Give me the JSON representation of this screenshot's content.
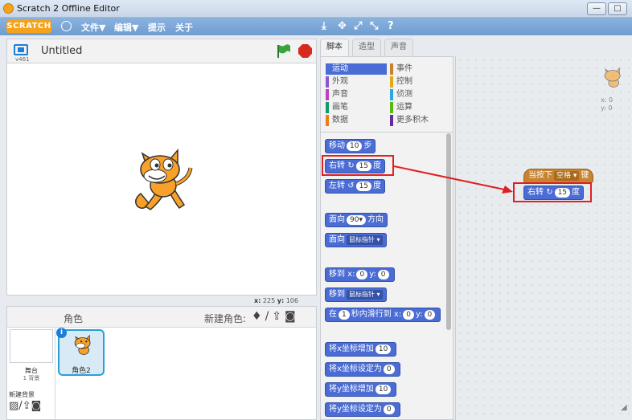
{
  "window": {
    "title": "Scratch 2 Offline Editor",
    "min_glyph": "—",
    "max_glyph": "□"
  },
  "menubar": {
    "logo": "SCRATCH",
    "file": "文件▼",
    "edit": "编辑▼",
    "tips": "提示",
    "about": "关于",
    "tools": [
      "⤓",
      "✥",
      "⤢",
      "⤡",
      "?"
    ]
  },
  "stage": {
    "version": "v461",
    "project_title": "Untitled",
    "coords": {
      "x_label": "x:",
      "x": "225",
      "y_label": "y:",
      "y": "106"
    }
  },
  "sprites": {
    "label": "角色",
    "new_sprite_label": "新建角色:",
    "stage_name": "舞台",
    "stage_backdrops": "1 背景",
    "new_backdrop_label": "新建背景",
    "sprite_name": "角色2",
    "info": "i"
  },
  "tabs": [
    "脚本",
    "造型",
    "声音"
  ],
  "categories": [
    {
      "label": "运动",
      "color": "#4a6cd4",
      "selected": true
    },
    {
      "label": "事件",
      "color": "#c88330"
    },
    {
      "label": "外观",
      "color": "#8a55d7"
    },
    {
      "label": "控制",
      "color": "#e1a91a"
    },
    {
      "label": "声音",
      "color": "#bb42c3"
    },
    {
      "label": "侦测",
      "color": "#2ca5e2"
    },
    {
      "label": "画笔",
      "color": "#0e9a6c"
    },
    {
      "label": "运算",
      "color": "#5cb712"
    },
    {
      "label": "数据",
      "color": "#ee7d16"
    },
    {
      "label": "更多积木",
      "color": "#632d99"
    }
  ],
  "blocks": {
    "move": {
      "a": "移动",
      "n": "10",
      "b": "步"
    },
    "turn_right": {
      "a": "右转",
      "icon": "↻",
      "n": "15",
      "b": "度"
    },
    "turn_left": {
      "a": "左转",
      "icon": "↺",
      "n": "15",
      "b": "度"
    },
    "point_dir": {
      "a": "面向",
      "n": "90▾",
      "b": "方向"
    },
    "point_towards": {
      "a": "面向",
      "d": "鼠标指针 ▾"
    },
    "goto_xy": {
      "a": "移到 x:",
      "n1": "0",
      "m": "y:",
      "n2": "0"
    },
    "goto": {
      "a": "移到",
      "d": "鼠标指针 ▾"
    },
    "glide": {
      "a": "在",
      "n1": "1",
      "m": "秒内滑行到 x:",
      "n2": "0",
      "m2": "y:",
      "n3": "0"
    },
    "change_x": {
      "a": "将x坐标增加",
      "n": "10"
    },
    "set_x": {
      "a": "将x坐标设定为",
      "n": "0"
    },
    "change_y": {
      "a": "将y坐标增加",
      "n": "10"
    },
    "set_y": {
      "a": "将y坐标设定为",
      "n": "0"
    }
  },
  "script": {
    "hat": {
      "a": "当按下",
      "key": "空格 ▾",
      "b": "键"
    },
    "turn": {
      "a": "右转",
      "icon": "↻",
      "n": "15",
      "b": "度"
    },
    "sprite_x": "x: 0",
    "sprite_y": "y: 0"
  },
  "colors": {
    "motion": "#4a6cd4",
    "events": "#c88330",
    "highlight": "#e02020"
  }
}
